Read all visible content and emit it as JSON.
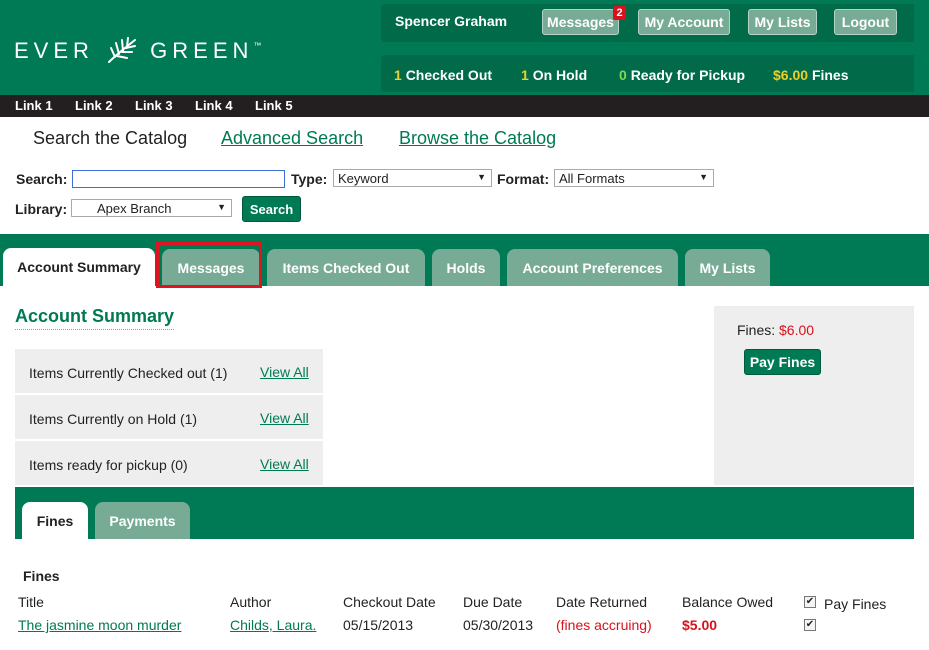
{
  "header": {
    "logo": {
      "left": "EVER",
      "right": "GREEN",
      "tm": "™"
    },
    "user": "Spencer Graham",
    "buttons": {
      "messages": "Messages",
      "messages_count": "2",
      "my_account": "My Account",
      "my_lists": "My Lists",
      "logout": "Logout"
    },
    "circ": {
      "checked_out_count": "1",
      "checked_out_label": "Checked Out",
      "on_hold_count": "1",
      "on_hold_label": "On Hold",
      "ready_count": "0",
      "ready_label": "Ready for Pickup",
      "fines_amount": "$6.00",
      "fines_label": "Fines"
    }
  },
  "links": [
    "Link 1",
    "Link 2",
    "Link 3",
    "Link 4",
    "Link 5"
  ],
  "search_nav": {
    "search": "Search the Catalog",
    "advanced": "Advanced Search",
    "browse": "Browse the Catalog"
  },
  "search": {
    "search_label": "Search:",
    "search_value": "",
    "type_label": "Type:",
    "type_value": "Keyword",
    "format_label": "Format:",
    "format_value": "All Formats",
    "library_label": "Library:",
    "library_value": "Apex Branch",
    "button": "Search"
  },
  "tabs": [
    "Account Summary",
    "Messages",
    "Items Checked Out",
    "Holds",
    "Account Preferences",
    "My Lists"
  ],
  "summary": {
    "title": "Account Summary",
    "rows": [
      {
        "text": "Items Currently Checked out (1)",
        "link": "View All"
      },
      {
        "text": "Items Currently on Hold (1)",
        "link": "View All"
      },
      {
        "text": "Items ready for pickup (0)",
        "link": "View All"
      }
    ],
    "fines_label": "Fines:",
    "fines_amount": "$6.00",
    "pay_button": "Pay Fines"
  },
  "subtabs": [
    "Fines",
    "Payments"
  ],
  "fines_table": {
    "heading": "Fines",
    "columns": [
      "Title",
      "Author",
      "Checkout Date",
      "Due Date",
      "Date Returned",
      "Balance Owed",
      "Pay Fines"
    ],
    "rows": [
      {
        "title": "The jasmine moon murder",
        "author": "Childs, Laura.",
        "checkout": "05/15/2013",
        "due": "05/30/2013",
        "returned": "(fines accruing)",
        "balance": "$5.00"
      }
    ]
  },
  "colors": {
    "brand": "#007a54",
    "dark_brand": "#006a49",
    "tab_inactive": "#77ab96",
    "alert": "#d9111b",
    "highlight": "#e0141e"
  }
}
